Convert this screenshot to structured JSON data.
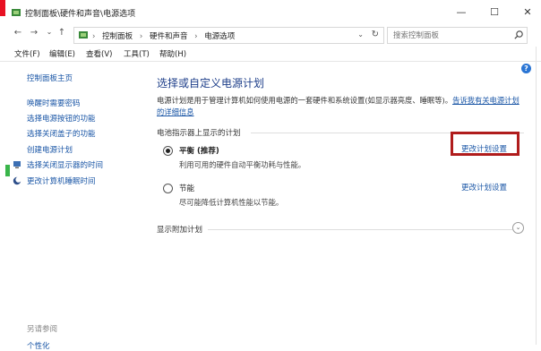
{
  "window": {
    "title": "控制面板\\硬件和声音\\电源选项",
    "minimize_glyph": "—",
    "maximize_glyph": "☐",
    "close_glyph": "✕"
  },
  "nav": {
    "back_glyph": "←",
    "forward_glyph": "→",
    "recent_glyph": "⌄",
    "up_glyph": "↑",
    "breadcrumbs": [
      "控制面板",
      "硬件和声音",
      "电源选项"
    ],
    "breadcrumb_separator": "›",
    "address_dropdown_glyph": "⌄",
    "refresh_glyph": "↻",
    "search_placeholder": "搜索控制面板"
  },
  "menu": [
    "文件(F)",
    "编辑(E)",
    "查看(V)",
    "工具(T)",
    "帮助(H)"
  ],
  "sidebar": {
    "home": "控制面板主页",
    "links": [
      "唤醒时需要密码",
      "选择电源按钮的功能",
      "选择关闭盖子的功能",
      "创建电源计划",
      "选择关闭显示器的时间",
      "更改计算机睡眠时间"
    ],
    "see_also": "另请参阅",
    "see_also_partial": "个性化"
  },
  "main": {
    "help_glyph": "?",
    "title": "选择或自定义电源计划",
    "description": "电源计划是用于管理计算机如何使用电源的一套硬件和系统设置(如显示器亮度、睡眠等)。",
    "description_link": "告诉我有关电源计划的详细信息",
    "group_label": "电池指示器上显示的计划",
    "plans": [
      {
        "name": "平衡 (推荐)",
        "description": "利用可用的硬件自动平衡功耗与性能。",
        "selected": true,
        "change_label": "更改计划设置"
      },
      {
        "name": "节能",
        "description": "尽可能降低计算机性能以节能。",
        "selected": false,
        "change_label": "更改计划设置"
      }
    ],
    "extra_plans_label": "显示附加计划",
    "expand_glyph": "⌄"
  },
  "colors": {
    "link": "#1a56a6",
    "title": "#1e3f8a",
    "highlight": "#b01c1c",
    "help": "#2a75d4"
  }
}
